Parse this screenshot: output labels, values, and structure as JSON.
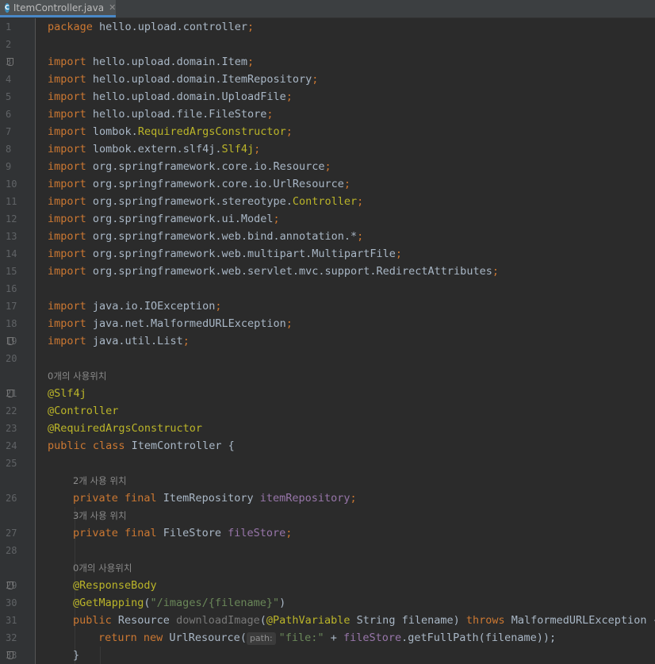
{
  "tab": {
    "filename": "ItemController.java",
    "icon_letter": "C",
    "close_glyph": "✕"
  },
  "colors": {
    "keyword": "#cc7832",
    "annotation": "#bbb529",
    "field": "#9876aa",
    "string": "#6a8759",
    "text": "#a9b7c6",
    "background": "#2b2b2b"
  },
  "code": {
    "ln": [
      "1",
      "2",
      "3",
      "4",
      "5",
      "6",
      "7",
      "8",
      "9",
      "10",
      "11",
      "12",
      "13",
      "14",
      "15",
      "16",
      "17",
      "18",
      "19",
      "20",
      "21",
      "22",
      "23",
      "24",
      "25",
      "26",
      "27",
      "28",
      "29",
      "30",
      "31",
      "32",
      "33"
    ],
    "l1": {
      "kw": "package",
      "rest": " hello.upload.controller",
      "semi": ";"
    },
    "imp": "import",
    "l3": " hello.upload.domain.Item",
    "l4": " hello.upload.domain.ItemRepository",
    "l5": " hello.upload.domain.UploadFile",
    "l6": " hello.upload.file.FileStore",
    "l7a": " lombok.",
    "l7b": "RequiredArgsConstructor",
    "l8a": " lombok.extern.slf4j.",
    "l8b": "Slf4j",
    "l9": " org.springframework.core.io.Resource",
    "l10": " org.springframework.core.io.UrlResource",
    "l11a": " org.springframework.stereotype.",
    "l11b": "Controller",
    "l12": " org.springframework.ui.Model",
    "l13": " org.springframework.web.bind.annotation.*",
    "l14": " org.springframework.web.multipart.MultipartFile",
    "l15": " org.springframework.web.servlet.mvc.support.RedirectAttributes",
    "l17": " java.io.IOException",
    "l18": " java.net.MalformedURLException",
    "l19": " java.util.List",
    "semi": ";",
    "hint0": "0개의 사용위치",
    "hint2": "2개 사용 위치",
    "hint3": "3개 사용 위치",
    "a21": "@Slf4j",
    "a22": "@Controller",
    "a23": "@RequiredArgsConstructor",
    "l24kw": "public class",
    "l24rest": " ItemController {",
    "private_final": "private final",
    "l26type": " ItemRepository ",
    "l26fld": "itemRepository",
    "l27type": " FileStore ",
    "l27fld": "fileStore",
    "a29": "@ResponseBody",
    "a30": "@GetMapping",
    "l30open": "(",
    "l30str": "\"/images/{filename}\"",
    "l30close": ")",
    "l31kw": "public",
    "l31type": " Resource ",
    "l31m": "downloadImage",
    "l31p": "(",
    "l31ann": "@PathVariable",
    "l31args": " String filename) ",
    "l31throws": "throws",
    "l31rest": " MalformedURLException {",
    "l32kw": "return new",
    "l32cls": " UrlResource(",
    "l32inlay": "path:",
    "l32str": "\"file:\"",
    "l32plus": " + ",
    "l32fld": "fileStore",
    "l32rest": ".getFullPath(filename));",
    "l33": "}"
  }
}
